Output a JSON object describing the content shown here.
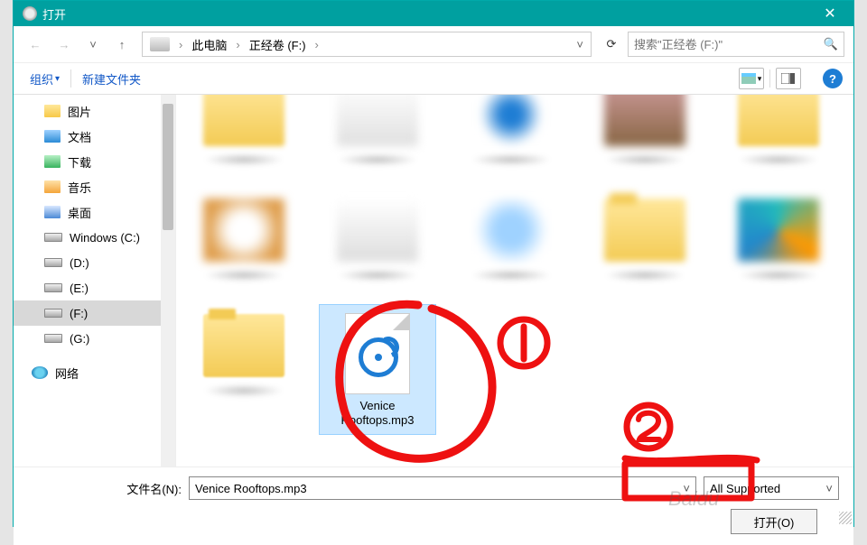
{
  "title": "打开",
  "breadcrumb": {
    "seg1": "此电脑",
    "seg2": "正经卷 (F:)"
  },
  "search": {
    "placeholder": "搜索\"正经卷 (F:)\""
  },
  "toolbar": {
    "organize": "组织",
    "newfolder": "新建文件夹"
  },
  "sidebar": {
    "items": [
      {
        "label": "图片",
        "iconClass": "fold-y"
      },
      {
        "label": "文档",
        "iconClass": "fold-b"
      },
      {
        "label": "下载",
        "iconClass": "fold-g"
      },
      {
        "label": "音乐",
        "iconClass": "fold-mus"
      },
      {
        "label": "桌面",
        "iconClass": "fold-c"
      },
      {
        "label": "Windows (C:)",
        "iconClass": "drv"
      },
      {
        "label": "(D:)",
        "iconClass": "drv"
      },
      {
        "label": "(E:)",
        "iconClass": "drv"
      },
      {
        "label": "(F:)",
        "iconClass": "drv",
        "selected": true
      },
      {
        "label": "(G:)",
        "iconClass": "drv"
      },
      {
        "label": "网络",
        "iconClass": "net"
      }
    ]
  },
  "selected_file": {
    "caption": "Venice Rooftops.mp3"
  },
  "filename_label": "文件名(N):",
  "filename_value": "Venice Rooftops.mp3",
  "filetype_value": "All Supported",
  "open_btn": "打开(O)",
  "watermark": "Baidu"
}
